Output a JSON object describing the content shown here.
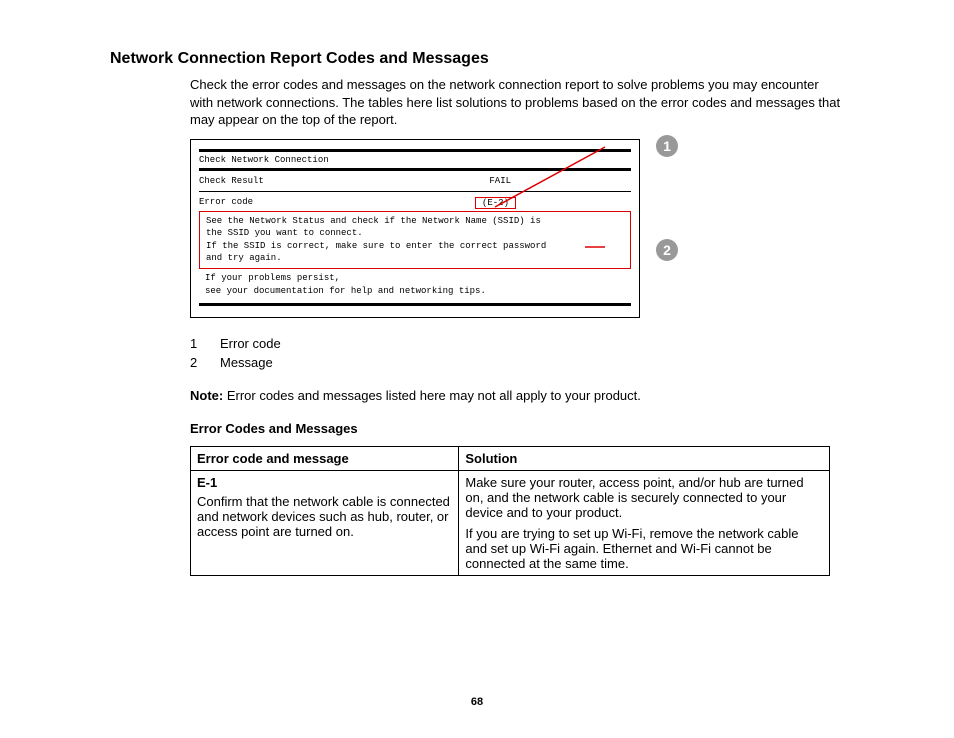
{
  "title": "Network Connection Report Codes and Messages",
  "intro": "Check the error codes and messages on the network connection report to solve problems you may encounter with network connections. The tables here list solutions to problems based on the error codes and messages that may appear on the top of the report.",
  "diagram": {
    "check_label": "Check Network Connection",
    "result_label": "Check Result",
    "result_value": "FAIL",
    "error_label": "Error code",
    "error_value": "(E-2)",
    "msg_l1": "See the Network Status and check if the Network Name (SSID) is",
    "msg_l2": "the SSID you want to connect.",
    "msg_l3": "If the SSID is correct, make sure to enter the correct password",
    "msg_l4": "and try again.",
    "persist_l1": "If your problems persist,",
    "persist_l2": "see your documentation for help and networking tips."
  },
  "callouts": {
    "c1": "1",
    "c2": "2"
  },
  "legend": {
    "n1": "1",
    "t1": "Error code",
    "n2": "2",
    "t2": "Message"
  },
  "note_label": "Note:",
  "note_text": " Error codes and messages listed here may not all apply to your product.",
  "subhead": "Error Codes and Messages",
  "table": {
    "h1": "Error code and message",
    "h2": "Solution",
    "r1_code": "E-1",
    "r1_msg": "Confirm that the network cable is connected and network devices such as hub, router, or access point are turned on.",
    "r1_sol1": "Make sure your router, access point, and/or hub are turned on, and the network cable is securely connected to your device and to your product.",
    "r1_sol2": "If you are trying to set up Wi-Fi, remove the network cable and set up Wi-Fi again. Ethernet and Wi-Fi cannot be connected at the same time."
  },
  "page_number": "68"
}
